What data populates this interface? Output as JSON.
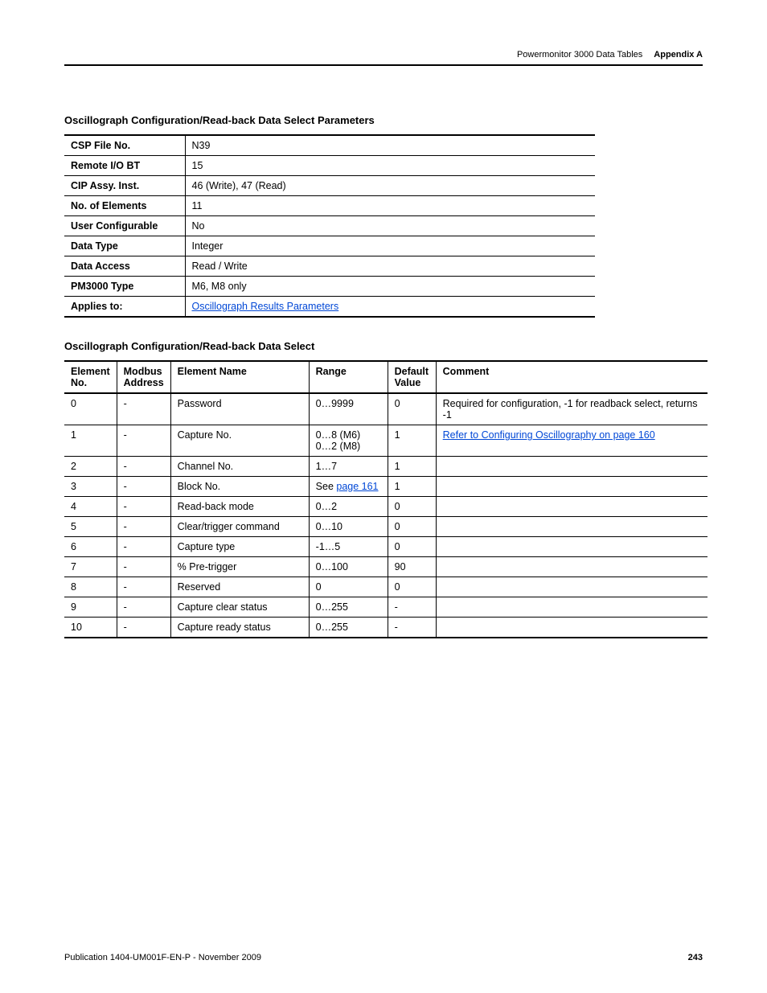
{
  "header": {
    "section": "Powermonitor 3000 Data Tables",
    "chapter": "Appendix A"
  },
  "title1": "Oscillograph Configuration/Read-back Data Select Parameters",
  "kv": [
    {
      "label": "CSP File No.",
      "value": "N39"
    },
    {
      "label": "Remote I/O BT",
      "value": "15"
    },
    {
      "label": "CIP Assy. Inst.",
      "value": "46 (Write), 47 (Read)"
    },
    {
      "label": "No. of Elements",
      "value": "11"
    },
    {
      "label": "User Configurable",
      "value": "No"
    },
    {
      "label": "Data Type",
      "value": "Integer"
    },
    {
      "label": "Data Access",
      "value": "Read / Write"
    },
    {
      "label": "PM3000 Type",
      "value": "M6, M8 only"
    },
    {
      "label": "Applies to:",
      "value": "Oscillograph Results Parameters",
      "link": true
    }
  ],
  "title2": "Oscillograph Configuration/Read-back Data Select",
  "table": {
    "headers": {
      "el_no": "Element No.",
      "modbus": "Modbus Address",
      "name": "Element Name",
      "range": "Range",
      "default": "Default Value",
      "comment": "Comment"
    },
    "rows": [
      {
        "no": "0",
        "modbus": "-",
        "name": "Password",
        "range": "0…9999",
        "default": "0",
        "comment": "Required for configuration, -1 for readback select, returns -1"
      },
      {
        "no": "1",
        "modbus": "-",
        "name": "Capture No.",
        "range": "0…8 (M6)\n0…2 (M8)",
        "default": "1",
        "comment": "Refer to Configuring Oscillography on page 160",
        "comment_link": true
      },
      {
        "no": "2",
        "modbus": "-",
        "name": "Channel No.",
        "range": "1…7",
        "default": "1",
        "comment": ""
      },
      {
        "no": "3",
        "modbus": "-",
        "name": "Block No.",
        "range_prefix": "See ",
        "range_link": "page 161",
        "default": "1",
        "comment": ""
      },
      {
        "no": "4",
        "modbus": "-",
        "name": "Read-back mode",
        "range": "0…2",
        "default": "0",
        "comment": ""
      },
      {
        "no": "5",
        "modbus": "-",
        "name": "Clear/trigger command",
        "range": "0…10",
        "default": "0",
        "comment": ""
      },
      {
        "no": "6",
        "modbus": "-",
        "name": "Capture type",
        "range": "-1…5",
        "default": "0",
        "comment": ""
      },
      {
        "no": "7",
        "modbus": "-",
        "name": "% Pre-trigger",
        "range": "0…100",
        "default": "90",
        "comment": ""
      },
      {
        "no": "8",
        "modbus": "-",
        "name": "Reserved",
        "range": "0",
        "default": "0",
        "comment": ""
      },
      {
        "no": "9",
        "modbus": "-",
        "name": "Capture clear status",
        "range": "0…255",
        "default": "-",
        "comment": ""
      },
      {
        "no": "10",
        "modbus": "-",
        "name": "Capture ready status",
        "range": "0…255",
        "default": "-",
        "comment": ""
      }
    ]
  },
  "footer": {
    "publication": "Publication 1404-UM001F-EN-P - November 2009",
    "page": "243"
  }
}
